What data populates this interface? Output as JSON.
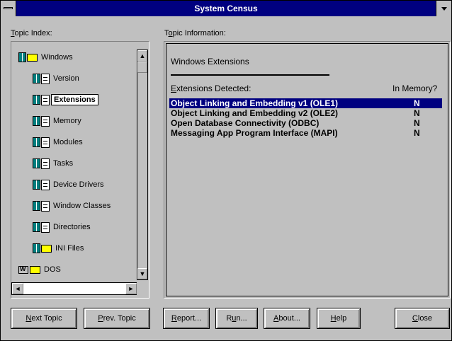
{
  "window": {
    "title": "System Census"
  },
  "topic_index": {
    "label_accel": "T",
    "label_rest": "opic Index:",
    "items": [
      {
        "label": "Windows",
        "icon": "windows-folder-icon",
        "indent": 0
      },
      {
        "label": "Version",
        "icon": "page-icon",
        "indent": 1
      },
      {
        "label": "Extensions",
        "icon": "page-icon",
        "indent": 1,
        "selected": true
      },
      {
        "label": "Memory",
        "icon": "page-icon",
        "indent": 1
      },
      {
        "label": "Modules",
        "icon": "page-icon",
        "indent": 1
      },
      {
        "label": "Tasks",
        "icon": "page-icon",
        "indent": 1
      },
      {
        "label": "Device Drivers",
        "icon": "page-icon",
        "indent": 1
      },
      {
        "label": "Window Classes",
        "icon": "page-icon",
        "indent": 1
      },
      {
        "label": "Directories",
        "icon": "page-icon",
        "indent": 1
      },
      {
        "label": "INI Files",
        "icon": "folder-icon",
        "indent": 1
      },
      {
        "label": "DOS",
        "icon": "dos-icon",
        "indent": 0
      }
    ]
  },
  "topic_info": {
    "label_pre": "T",
    "label_accel": "o",
    "label_rest": "pic Information:",
    "heading": "Windows Extensions",
    "col_ext_accel": "E",
    "col_ext_rest": "xtensions Detected:",
    "col_mem": "In Memory?",
    "extensions": [
      {
        "name": "Object Linking and Embedding v1 (OLE1)",
        "in_memory": "N"
      },
      {
        "name": "Object Linking and Embedding v2 (OLE2)",
        "in_memory": "N"
      },
      {
        "name": "Open Database Connectivity (ODBC)",
        "in_memory": "N"
      },
      {
        "name": "Messaging App Program Interface (MAPI)",
        "in_memory": "N"
      }
    ]
  },
  "buttons": {
    "next": {
      "accel": "N",
      "rest": "ext Topic"
    },
    "prev": {
      "accel": "P",
      "rest": "rev. Topic"
    },
    "report": {
      "accel": "R",
      "rest": "eport..."
    },
    "run": {
      "pre": "R",
      "accel": "u",
      "rest": "n..."
    },
    "about": {
      "accel": "A",
      "rest": "bout..."
    },
    "help": {
      "accel": "H",
      "rest": "elp"
    },
    "close": {
      "accel": "C",
      "rest": "lose"
    }
  },
  "colors": {
    "selection": "#000080",
    "face": "#c0c0c0",
    "tree_icon": "#008080"
  }
}
